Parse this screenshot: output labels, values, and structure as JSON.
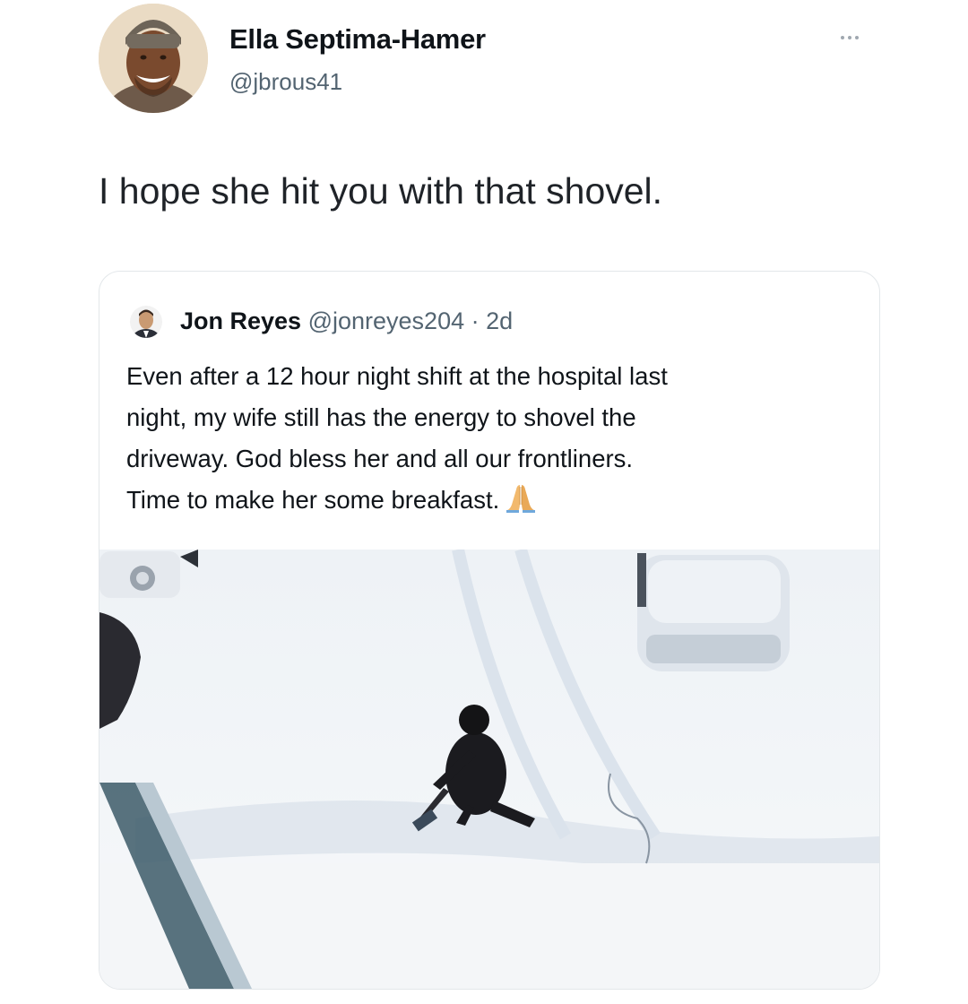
{
  "tweet": {
    "author_name": "Ella Septima-Hamer",
    "author_handle": "@jbrous41",
    "more_icon": "more-horizontal-icon",
    "text": "I hope she hit you with that shovel."
  },
  "quoted_tweet": {
    "author_name": "Jon Reyes",
    "author_handle": "@jonreyes204",
    "separator": "·",
    "time": "2d",
    "text_lines": [
      "Even after a 12 hour night shift at the hospital last",
      "night, my wife still has the energy to shovel the",
      "driveway. God bless her and all our frontliners.",
      "Time to make her some breakfast."
    ],
    "emoji_icon": "folded-hands-icon",
    "media": "photo of a woman shoveling a snowy driveway next to a snow-covered car"
  },
  "colors": {
    "text_primary": "#0f1419",
    "text_secondary": "#536471",
    "border": "#e3e7ea",
    "background": "#ffffff"
  }
}
